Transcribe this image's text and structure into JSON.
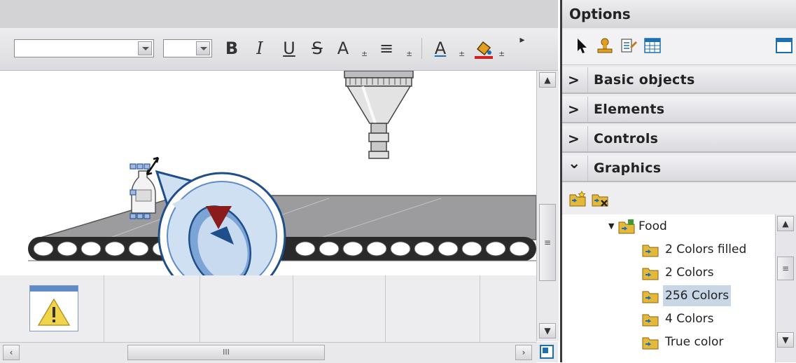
{
  "editor": {
    "toolbar": {
      "bold_label": "B",
      "italic_label": "I",
      "underline_label": "U",
      "strike_label": "S",
      "fontsize_label": "A",
      "align_label": "≡",
      "fontcolor_label": "A",
      "dropdown_glyph": "±",
      "more_glyph": "▸"
    },
    "hscroll_label": "III",
    "vscroll_grip": "≡"
  },
  "options": {
    "title": "Options",
    "sections": [
      {
        "label": "Basic objects",
        "chevron": ">"
      },
      {
        "label": "Elements",
        "chevron": ">"
      },
      {
        "label": "Controls",
        "chevron": ">"
      },
      {
        "label": "Graphics",
        "chevron": "⌄"
      }
    ],
    "tree": {
      "folder": "Food",
      "items": [
        "2 Colors filled",
        "2 Colors",
        "256 Colors",
        "4 Colors",
        "True color"
      ],
      "selected_index": 2
    },
    "tree_scroll_grip": "≡"
  },
  "colors": {
    "accent": "#1e6fb0",
    "selection": "#c8d6e6",
    "warning": "#f0d54a",
    "marker_red": "#8b1c1c"
  }
}
